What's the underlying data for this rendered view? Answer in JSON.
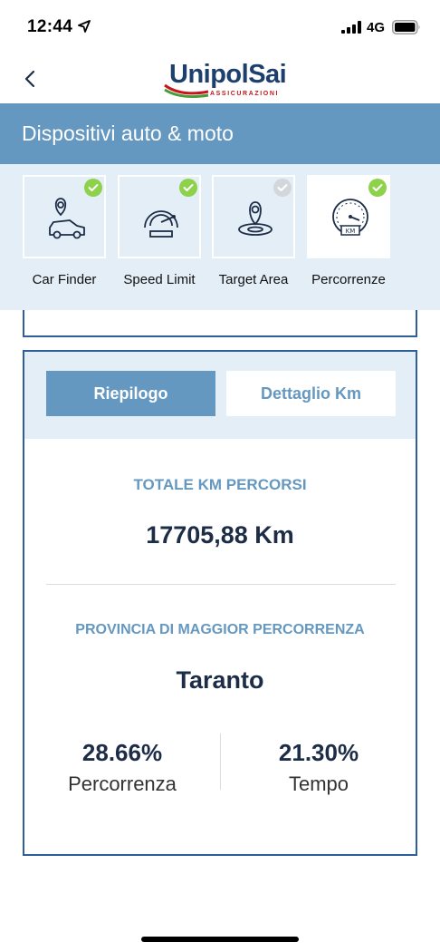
{
  "status_bar": {
    "time": "12:44",
    "network": "4G"
  },
  "header": {
    "logo_text": "UnipolSai",
    "logo_sub": "ASSICURAZIONI",
    "title": "Dispositivi auto & moto"
  },
  "devices": [
    {
      "label": "Car Finder",
      "status": "checked"
    },
    {
      "label": "Speed Limit",
      "status": "checked"
    },
    {
      "label": "Target Area",
      "status": "unchecked"
    },
    {
      "label": "Percorrenze",
      "status": "checked",
      "selected": true
    }
  ],
  "tabs": {
    "summary": "Riepilogo",
    "detail": "Dettaglio Km",
    "active": "summary"
  },
  "summary": {
    "total_km_title": "TOTALE KM PERCORSI",
    "total_km_value": "17705,88 Km",
    "province_title": "PROVINCIA DI MAGGIOR PERCORRENZA",
    "province_value": "Taranto",
    "stats": [
      {
        "value": "28.66%",
        "label": "Percorrenza"
      },
      {
        "value": "21.30%",
        "label": "Tempo"
      }
    ]
  },
  "colors": {
    "primary": "#6598c0",
    "dark_navy": "#1d2d47",
    "light_bg": "#e4eef7",
    "border": "#2e5f9b",
    "check_green": "#8ed14a"
  },
  "icons": [
    "location-arrow-icon",
    "signal-icon",
    "battery-icon",
    "back-chevron-icon",
    "car-finder-icon",
    "speedometer-icon",
    "target-area-icon",
    "odometer-icon",
    "check-icon"
  ]
}
